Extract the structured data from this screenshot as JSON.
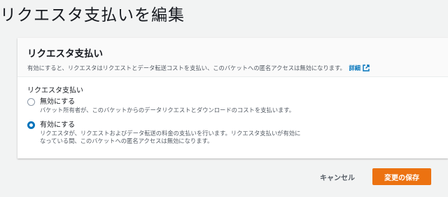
{
  "page": {
    "title": "リクエスタ支払いを編集"
  },
  "panel": {
    "title": "リクエスタ支払い",
    "description": "有効にすると、リクエスタはリクエストとデータ転送コストを支払い、このバケットへの匿名アクセスは無効になります。",
    "info_link": "詳細",
    "info_icon": "external-link-icon",
    "field_label": "リクエスタ支払い",
    "options": [
      {
        "label": "無効にする",
        "description": "バケット所有者が、このバケットからのデータリクエストとダウンロードのコストを支払います。",
        "selected": false
      },
      {
        "label": "有効にする",
        "description_line1": "リクエスタが、リクエストおよびデータ転送の料金の支払いを行います。リクエスタ支払いが有効に",
        "description_line2": "なっている間、このバケットへの匿名アクセスは無効になります。",
        "selected": true
      }
    ]
  },
  "actions": {
    "cancel_label": "キャンセル",
    "save_label": "変更の保存"
  },
  "colors": {
    "accent": "#0073bb",
    "primary_button": "#ec7211",
    "background": "#f2f3f3"
  }
}
